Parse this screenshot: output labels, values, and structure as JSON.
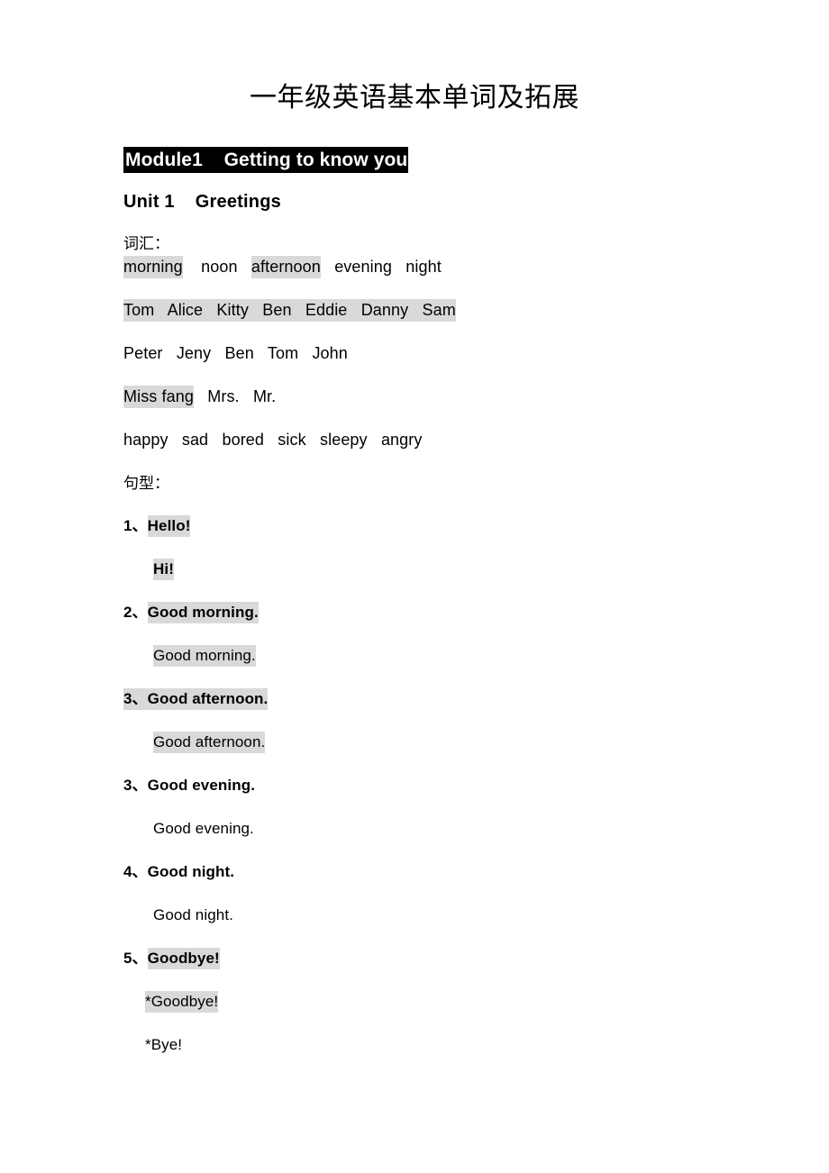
{
  "document": {
    "title": "一年级英语基本单词及拓展",
    "module_header": "Module1    Getting to know you",
    "unit_heading": "Unit 1    Greetings",
    "vocab_label": "词汇：",
    "pattern_label": "句型："
  },
  "colors": {
    "highlight": "#d9d9d9",
    "header_background": "#000000",
    "header_text": "#ffffff",
    "body_text": "#000000",
    "page_background": "#ffffff"
  },
  "vocabulary": {
    "rows": [
      {
        "id": "times-of-day",
        "segments": [
          {
            "text": "morning",
            "highlight": true
          },
          {
            "text": "    ",
            "highlight": false
          },
          {
            "text": "noon",
            "highlight": false
          },
          {
            "text": "   ",
            "highlight": false
          },
          {
            "text": "afternoon",
            "highlight": true
          },
          {
            "text": "   ",
            "highlight": false
          },
          {
            "text": "evening",
            "highlight": false
          },
          {
            "text": "   ",
            "highlight": false
          },
          {
            "text": "night",
            "highlight": false
          }
        ]
      },
      {
        "id": "names-row-1",
        "segments": [
          {
            "text": "Tom   Alice   Kitty   Ben   Eddie   Danny   Sam",
            "highlight": true
          }
        ]
      },
      {
        "id": "names-row-2",
        "segments": [
          {
            "text": "Peter   Jeny   Ben   Tom   John",
            "highlight": false
          }
        ]
      },
      {
        "id": "titles-row",
        "segments": [
          {
            "text": "Miss fang",
            "highlight": true
          },
          {
            "text": "   ",
            "highlight": false
          },
          {
            "text": "Mrs.",
            "highlight": false
          },
          {
            "text": "   ",
            "highlight": false
          },
          {
            "text": "Mr.",
            "highlight": false
          }
        ]
      },
      {
        "id": "feelings-row",
        "segments": [
          {
            "text": "happy   sad   bored   sick   sleepy   angry",
            "highlight": false
          }
        ]
      }
    ]
  },
  "patterns": [
    {
      "id": "pattern-1-hello",
      "prompt": {
        "segments": [
          {
            "text": "1、",
            "highlight": false
          },
          {
            "text": "Hello!",
            "highlight": true
          }
        ]
      },
      "reply": {
        "bold": true,
        "narrow": false,
        "segments": [
          {
            "text": "Hi!",
            "highlight": true
          }
        ]
      }
    },
    {
      "id": "pattern-2-good-morning",
      "prompt": {
        "segments": [
          {
            "text": "2、",
            "highlight": false
          },
          {
            "text": "Good morning.",
            "highlight": true
          }
        ]
      },
      "reply": {
        "bold": false,
        "narrow": false,
        "segments": [
          {
            "text": "Good morning.",
            "highlight": true
          }
        ]
      }
    },
    {
      "id": "pattern-3-good-afternoon",
      "prompt": {
        "segments": [
          {
            "text": "3、Good afternoon.",
            "highlight": true
          }
        ]
      },
      "reply": {
        "bold": false,
        "narrow": false,
        "segments": [
          {
            "text": "Good afternoon.",
            "highlight": true
          }
        ]
      }
    },
    {
      "id": "pattern-3-good-evening",
      "prompt": {
        "segments": [
          {
            "text": "3、Good evening.",
            "highlight": false
          }
        ]
      },
      "reply": {
        "bold": false,
        "narrow": false,
        "segments": [
          {
            "text": "Good evening.",
            "highlight": false
          }
        ]
      }
    },
    {
      "id": "pattern-4-good-night",
      "prompt": {
        "segments": [
          {
            "text": "4、Good night.",
            "highlight": false
          }
        ]
      },
      "reply": {
        "bold": false,
        "narrow": false,
        "segments": [
          {
            "text": "Good night.",
            "highlight": false
          }
        ]
      }
    },
    {
      "id": "pattern-5-goodbye",
      "prompt": {
        "segments": [
          {
            "text": "5、",
            "highlight": false
          },
          {
            "text": "Goodbye!",
            "highlight": true
          }
        ]
      },
      "reply": {
        "bold": false,
        "narrow": true,
        "segments": [
          {
            "text": "*Goodbye!",
            "highlight": true
          }
        ]
      },
      "reply2": {
        "bold": false,
        "narrow": true,
        "segments": [
          {
            "text": "*Bye!",
            "highlight": false
          }
        ]
      }
    }
  ]
}
